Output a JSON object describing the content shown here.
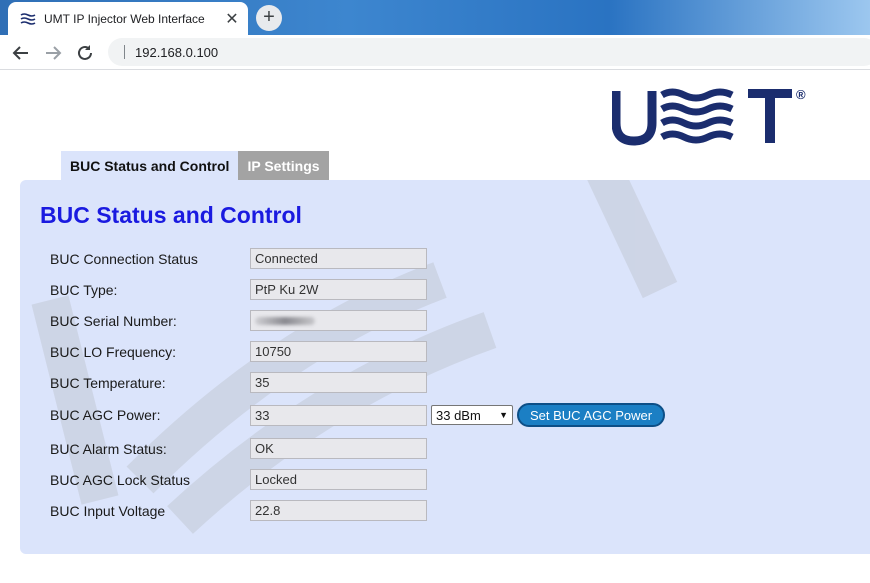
{
  "browser": {
    "tab_title": "UMT IP Injector Web Interface",
    "close_glyph": "✕",
    "new_tab_glyph": "+",
    "address": "192.168.0.100"
  },
  "logo": {
    "text": "UMT",
    "registered": "®"
  },
  "page_tabs": [
    {
      "label": "BUC Status and Control",
      "active": true
    },
    {
      "label": "IP Settings",
      "active": false
    }
  ],
  "panel": {
    "title": "BUC Status and Control",
    "rows": [
      {
        "label": "BUC Connection Status",
        "value": "Connected"
      },
      {
        "label": "BUC Type:",
        "value": "PtP Ku 2W"
      },
      {
        "label": "BUC Serial Number:",
        "value": ""
      },
      {
        "label": "BUC LO Frequency:",
        "value": "10750"
      },
      {
        "label": "BUC Temperature:",
        "value": "35"
      },
      {
        "label": "BUC AGC Power:",
        "value": "33"
      },
      {
        "label": "BUC Alarm Status:",
        "value": "OK"
      },
      {
        "label": "BUC AGC Lock Status",
        "value": "Locked"
      },
      {
        "label": "BUC Input Voltage",
        "value": "22.8"
      }
    ],
    "agc_select_value": "33 dBm",
    "agc_button_label": "Set BUC AGC Power"
  },
  "colors": {
    "brand_navy": "#1b2d6e",
    "title_blue": "#1a1ae0",
    "panel_bg": "#dbe4fb",
    "button_blue": "#1b7fc4"
  }
}
